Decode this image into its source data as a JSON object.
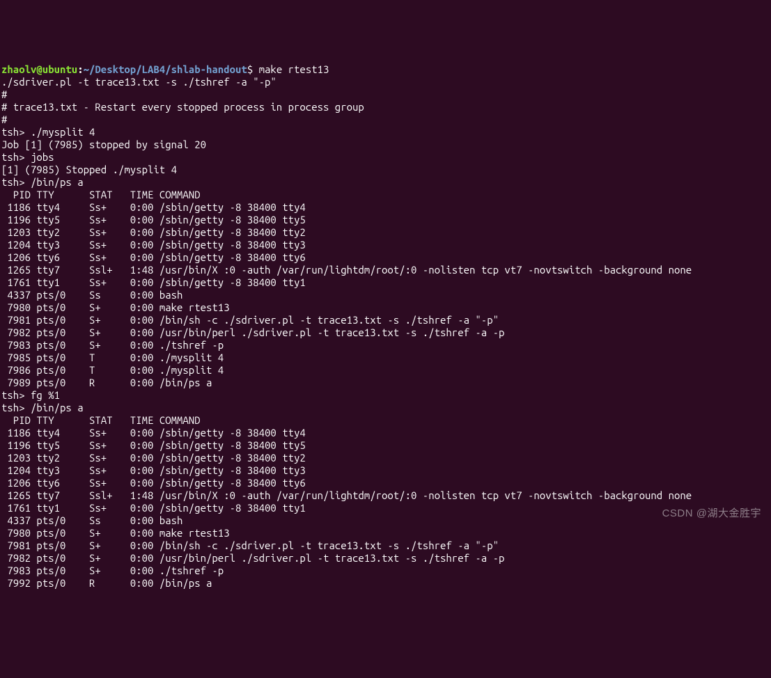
{
  "prompt": {
    "user_host": "zhaolv@ubuntu",
    "path": "~/Desktop/LAB4/shlab-handout",
    "cmd": "make rtest13"
  },
  "lines": {
    "l01": "./sdriver.pl -t trace13.txt -s ./tshref -a \"-p\"",
    "l02": "#",
    "l03": "# trace13.txt - Restart every stopped process in process group",
    "l04": "#",
    "l05": "tsh> ./mysplit 4",
    "l06": "Job [1] (7985) stopped by signal 20",
    "l07": "tsh> jobs",
    "l08": "[1] (7985) Stopped ./mysplit 4",
    "l09": "tsh> /bin/ps a",
    "l10": "  PID TTY      STAT   TIME COMMAND",
    "l11": " 1186 tty4     Ss+    0:00 /sbin/getty -8 38400 tty4",
    "l12": " 1196 tty5     Ss+    0:00 /sbin/getty -8 38400 tty5",
    "l13": " 1203 tty2     Ss+    0:00 /sbin/getty -8 38400 tty2",
    "l14": " 1204 tty3     Ss+    0:00 /sbin/getty -8 38400 tty3",
    "l15": " 1206 tty6     Ss+    0:00 /sbin/getty -8 38400 tty6",
    "l16": " 1265 tty7     Ssl+   1:48 /usr/bin/X :0 -auth /var/run/lightdm/root/:0 -nolisten tcp vt7 -novtswitch -background none",
    "l17": " 1761 tty1     Ss+    0:00 /sbin/getty -8 38400 tty1",
    "l18": " 4337 pts/0    Ss     0:00 bash",
    "l19": " 7980 pts/0    S+     0:00 make rtest13",
    "l20": " 7981 pts/0    S+     0:00 /bin/sh -c ./sdriver.pl -t trace13.txt -s ./tshref -a \"-p\"",
    "l21": " 7982 pts/0    S+     0:00 /usr/bin/perl ./sdriver.pl -t trace13.txt -s ./tshref -a -p",
    "l22": " 7983 pts/0    S+     0:00 ./tshref -p",
    "l23": " 7985 pts/0    T      0:00 ./mysplit 4",
    "l24": " 7986 pts/0    T      0:00 ./mysplit 4",
    "l25": " 7989 pts/0    R      0:00 /bin/ps a",
    "l26": "tsh> fg %1",
    "l27": "tsh> /bin/ps a",
    "l28": "  PID TTY      STAT   TIME COMMAND",
    "l29": " 1186 tty4     Ss+    0:00 /sbin/getty -8 38400 tty4",
    "l30": " 1196 tty5     Ss+    0:00 /sbin/getty -8 38400 tty5",
    "l31": " 1203 tty2     Ss+    0:00 /sbin/getty -8 38400 tty2",
    "l32": " 1204 tty3     Ss+    0:00 /sbin/getty -8 38400 tty3",
    "l33": " 1206 tty6     Ss+    0:00 /sbin/getty -8 38400 tty6",
    "l34": " 1265 tty7     Ssl+   1:48 /usr/bin/X :0 -auth /var/run/lightdm/root/:0 -nolisten tcp vt7 -novtswitch -background none",
    "l35": " 1761 tty1     Ss+    0:00 /sbin/getty -8 38400 tty1",
    "l36": " 4337 pts/0    Ss     0:00 bash",
    "l37": " 7980 pts/0    S+     0:00 make rtest13",
    "l38": " 7981 pts/0    S+     0:00 /bin/sh -c ./sdriver.pl -t trace13.txt -s ./tshref -a \"-p\"",
    "l39": " 7982 pts/0    S+     0:00 /usr/bin/perl ./sdriver.pl -t trace13.txt -s ./tshref -a -p",
    "l40": " 7983 pts/0    S+     0:00 ./tshref -p",
    "l41": " 7992 pts/0    R      0:00 /bin/ps a"
  },
  "watermark": "CSDN @湖大金胜宇"
}
